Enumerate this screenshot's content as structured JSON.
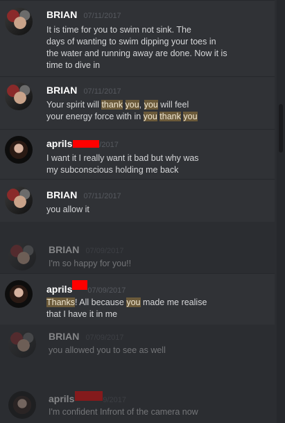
{
  "messages": [
    {
      "author": "BRIAN",
      "time": "07/11/2017",
      "lines": [
        "It is time for you to swim not sink. The",
        "days of wanting to swim dipping your toes in",
        "the water and running away are done. Now it is",
        "time to dive in"
      ]
    },
    {
      "author": "BRIAN",
      "time": "07/11/2017",
      "text1a": "Your spirit will ",
      "hl1": "thank",
      "text1b": " ",
      "hl2": "you",
      "text1c": ", ",
      "hl3": "you",
      "text1d": " will feel",
      "text2a": "your energy force with in ",
      "hl4": "you",
      "text2b": " ",
      "hl5": "thank",
      "text2c": " ",
      "hl6": "you"
    },
    {
      "author": "aprils",
      "time": "/2017",
      "lines": [
        "I want it I really want it bad but why was",
        "my subconscious holding me back"
      ]
    },
    {
      "author": "BRIAN",
      "time": "07/11/2017",
      "lines": [
        "you allow it"
      ]
    },
    {
      "author": "BRIAN",
      "time": "07/09/2017",
      "lines": [
        "I'm so happy for you!!"
      ]
    },
    {
      "author": "aprils",
      "time": "07/09/2017",
      "hl1": "Thanks",
      "text1a": "! All because ",
      "hl2": "you",
      "text1b": " made me realise",
      "text2": "that I have it in me"
    },
    {
      "author": "BRIAN",
      "time": "07/09/2017",
      "lines": [
        "you allowed you to see as well"
      ]
    },
    {
      "author": "aprils",
      "time": "9/2017",
      "lines": [
        "I'm confident Infront of the camera now"
      ]
    }
  ]
}
